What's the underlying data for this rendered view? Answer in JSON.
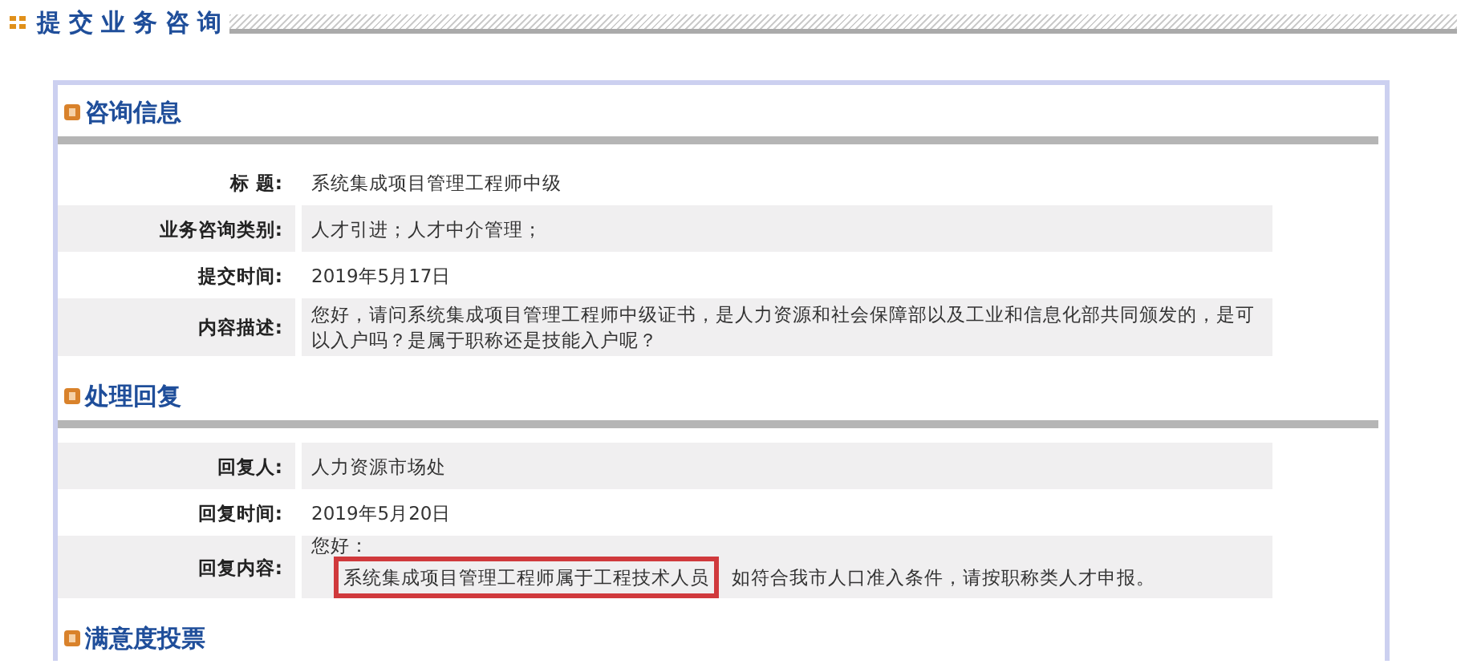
{
  "page_title": "提交业务咨询",
  "sections": [
    {
      "title": "咨询信息",
      "rows": [
        {
          "label": "标 题:",
          "value": "系统集成项目管理工程师中级"
        },
        {
          "label": "业务咨询类别:",
          "value": "人才引进；人才中介管理；"
        },
        {
          "label": "提交时间:",
          "value": "2019年5月17日"
        },
        {
          "label": "内容描述:",
          "value": "您好，请问系统集成项目管理工程师中级证书，是人力资源和社会保障部以及工业和信息化部共同颁发的，是可以入户吗？是属于职称还是技能入户呢？"
        }
      ]
    },
    {
      "title": "处理回复",
      "rows": [
        {
          "label": "回复人:",
          "value": "人力资源市场处"
        },
        {
          "label": "回复时间:",
          "value": "2019年5月20日"
        },
        {
          "label": "回复内容:",
          "greeting": "您好：",
          "segments": [
            {
              "text": "系统集成项目管理工程师属于工程技术人员",
              "highlighted": true
            },
            {
              "text": "如符合我市人口准入条件，请按职称类人才申报。",
              "highlighted": false
            }
          ]
        }
      ]
    },
    {
      "title": "满意度投票"
    }
  ]
}
